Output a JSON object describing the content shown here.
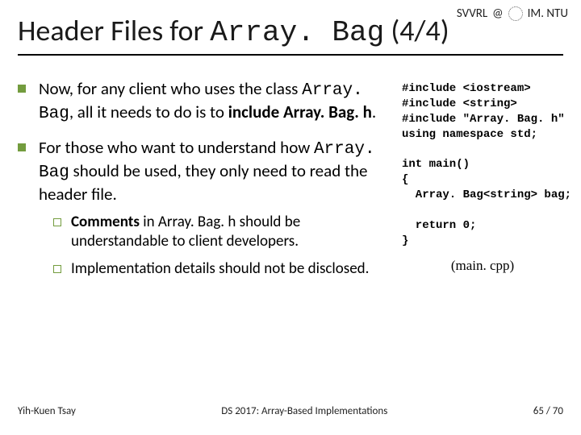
{
  "header": {
    "svvrl": "SVVRL",
    "at": "@",
    "dept": "IM. NTU"
  },
  "title_prefix": "Header Files for ",
  "title_code": "Array. Bag",
  "title_suffix": " (4/4)",
  "bullets": {
    "b1_a": "Now, for any client who uses the class ",
    "b1_code1": "Array. Bag",
    "b1_b": ", all it needs to do is to ",
    "b1_c": "include Array. Bag. h",
    "b1_d": ".",
    "b2_a": "For those who want to understand how ",
    "b2_code1": "Array. Bag",
    "b2_b": " should be used, they only need to read the header file.",
    "s1_a": "Comments",
    "s1_b": " in Array. Bag. h should be understandable to client developers.",
    "s2": "Implementation details should not be disclosed."
  },
  "code": {
    "line1": "#include <iostream>",
    "line2": "#include <string>",
    "line3": "#include \"Array. Bag. h\"",
    "line4": "using namespace std;",
    "line5": "",
    "line6": "int main()",
    "line7": "{",
    "line8": "  Array. Bag<string> bag;",
    "line9": "",
    "line10": "  return 0;",
    "line11": "}"
  },
  "caption": "(main. cpp)",
  "footer": {
    "left": "Yih-Kuen Tsay",
    "center": "DS 2017: Array-Based Implementations",
    "right": "65 / 70"
  }
}
